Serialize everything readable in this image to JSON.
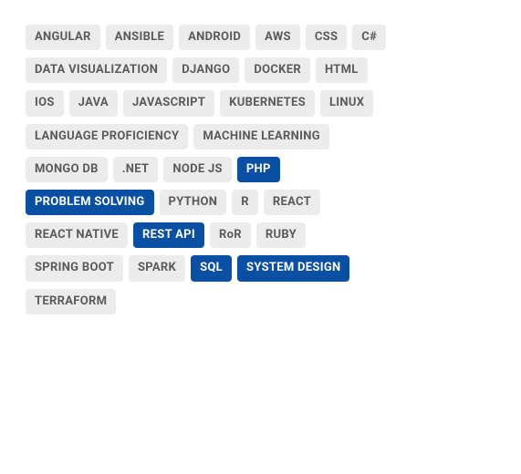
{
  "tags": [
    {
      "label": "ANGULAR",
      "selected": false
    },
    {
      "label": "ANSIBLE",
      "selected": false
    },
    {
      "label": "ANDROID",
      "selected": false
    },
    {
      "label": "AWS",
      "selected": false
    },
    {
      "label": "CSS",
      "selected": false
    },
    {
      "label": "C#",
      "selected": false
    },
    {
      "label": "DATA VISUALIZATION",
      "selected": false
    },
    {
      "label": "DJANGO",
      "selected": false
    },
    {
      "label": "DOCKER",
      "selected": false
    },
    {
      "label": "HTML",
      "selected": false
    },
    {
      "label": "IOS",
      "selected": false
    },
    {
      "label": "JAVA",
      "selected": false
    },
    {
      "label": "JAVASCRIPT",
      "selected": false
    },
    {
      "label": "KUBERNETES",
      "selected": false
    },
    {
      "label": "LINUX",
      "selected": false
    },
    {
      "label": "LANGUAGE PROFICIENCY",
      "selected": false
    },
    {
      "label": "MACHINE LEARNING",
      "selected": false
    },
    {
      "label": "MONGO DB",
      "selected": false
    },
    {
      "label": ".NET",
      "selected": false
    },
    {
      "label": "NODE JS",
      "selected": false
    },
    {
      "label": "PHP",
      "selected": true
    },
    {
      "label": "PROBLEM SOLVING",
      "selected": true
    },
    {
      "label": "PYTHON",
      "selected": false
    },
    {
      "label": "R",
      "selected": false
    },
    {
      "label": "REACT",
      "selected": false
    },
    {
      "label": "REACT NATIVE",
      "selected": false
    },
    {
      "label": "REST API",
      "selected": true
    },
    {
      "label": "RoR",
      "selected": false
    },
    {
      "label": "RUBY",
      "selected": false
    },
    {
      "label": "SPRING BOOT",
      "selected": false
    },
    {
      "label": "SPARK",
      "selected": false
    },
    {
      "label": "SQL",
      "selected": true
    },
    {
      "label": "SYSTEM DESIGN",
      "selected": true
    },
    {
      "label": "TERRAFORM",
      "selected": false
    }
  ],
  "colors": {
    "selected_bg": "#094fa3",
    "selected_fg": "#ffffff",
    "unselected_bg": "#ececec",
    "unselected_fg": "#5a5a5a"
  }
}
